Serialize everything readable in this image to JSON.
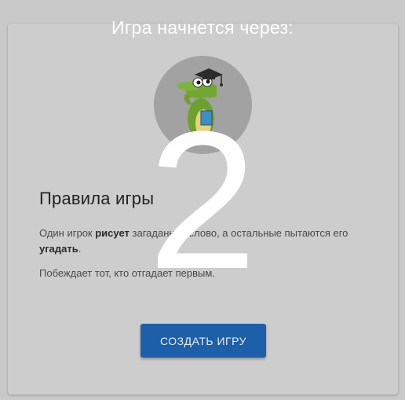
{
  "rules": {
    "title": "Правила игры",
    "line1_before": "Один игрок ",
    "line1_bold1": "рисует",
    "line1_middle": " загадaнное слово, а остальные пытаются его ",
    "line1_bold2": "угадать",
    "line1_after": ".",
    "line2": "Побеждает тот, кто отгадает первым."
  },
  "actions": {
    "create_game_label": "СОЗДАТЬ ИГРУ"
  },
  "countdown": {
    "label": "Игра начнется через:",
    "value": "2"
  },
  "colors": {
    "overlay": "#c9c9c9",
    "button": "#1d5fa8",
    "countdown_text": "#ffffff"
  },
  "mascot": {
    "icon": "crocodile-graduate-icon"
  }
}
